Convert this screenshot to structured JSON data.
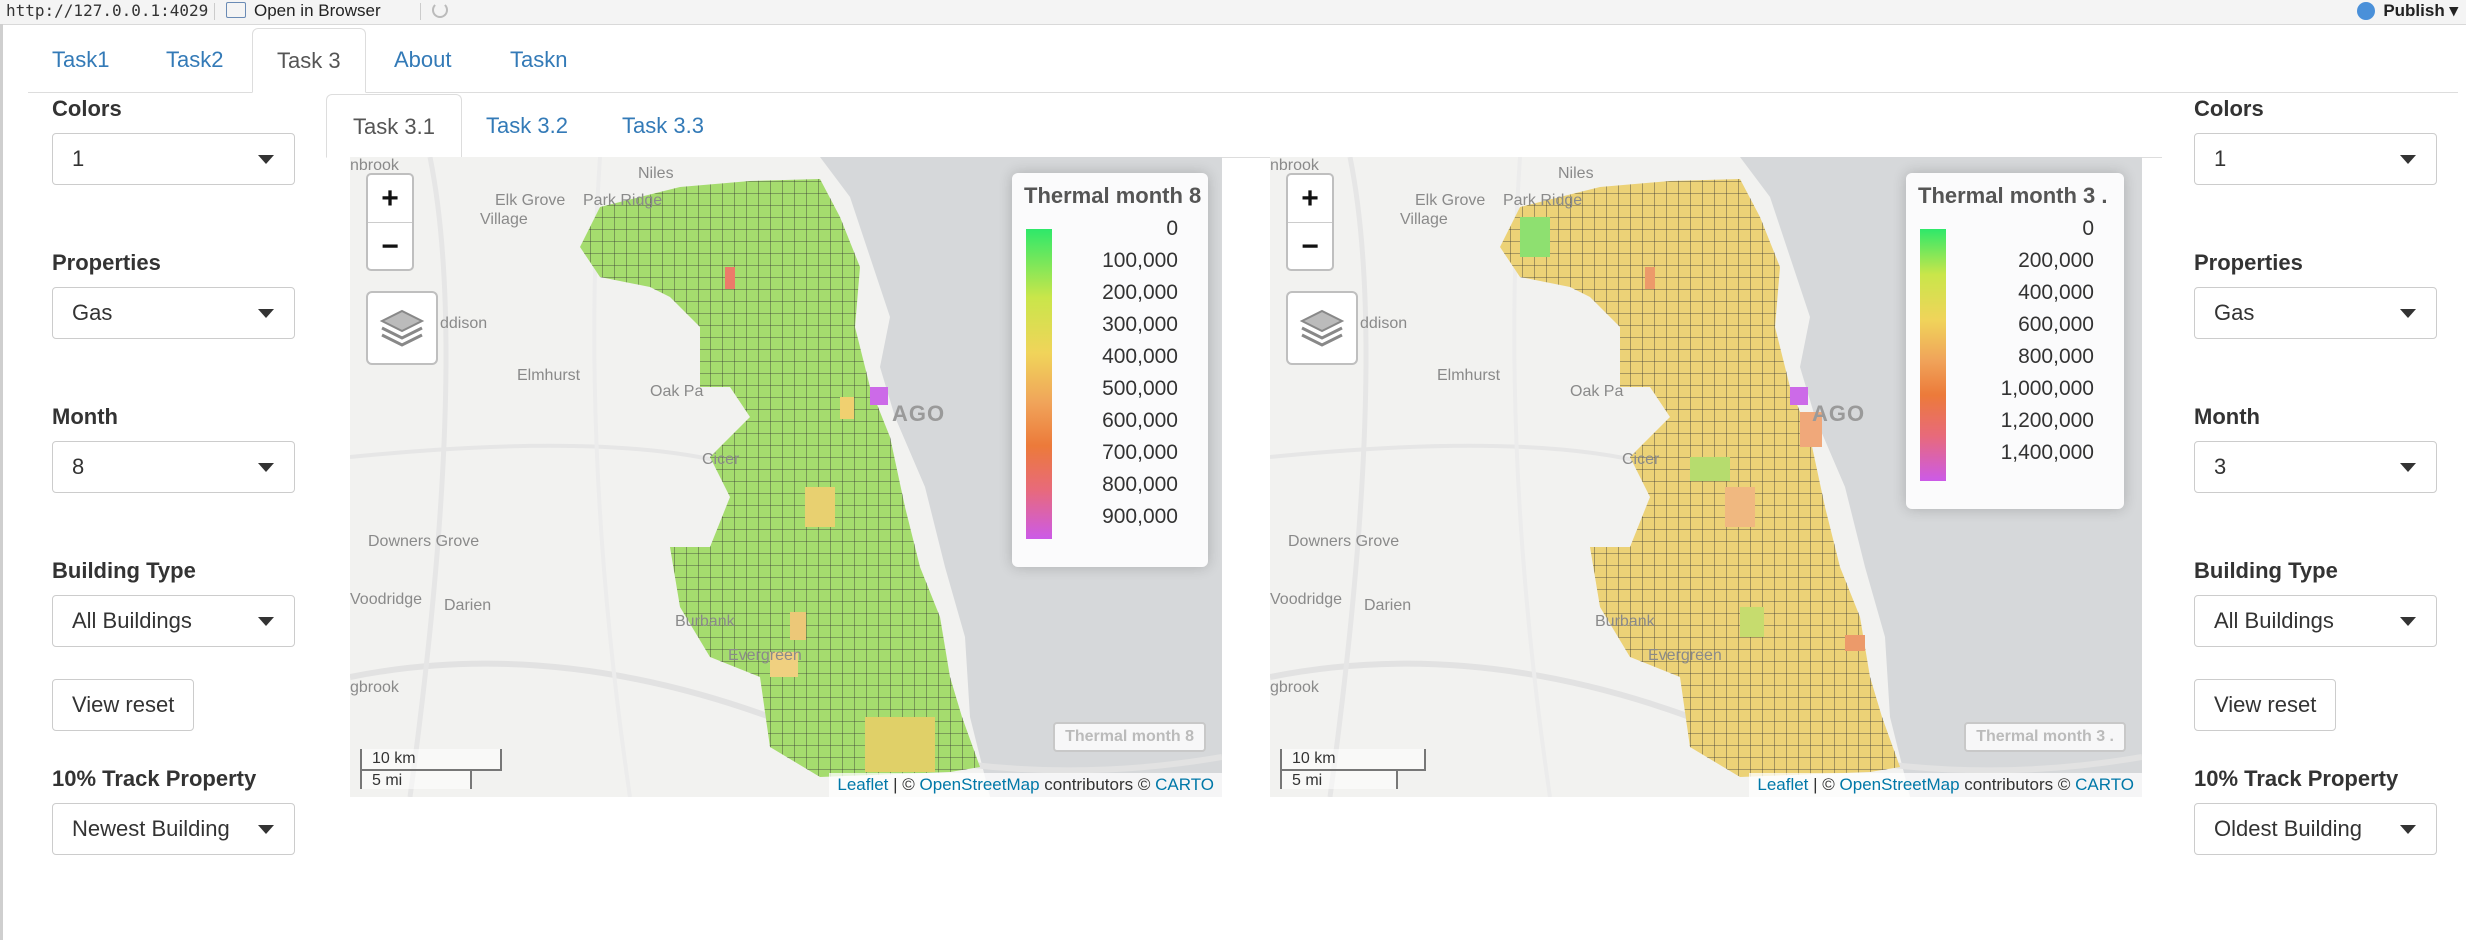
{
  "browser": {
    "url": "http://127.0.0.1:4029",
    "open_in_browser": "Open in Browser",
    "publish": "Publish"
  },
  "main_tabs": [
    "Task1",
    "Task2",
    "Task 3",
    "About",
    "Taskn"
  ],
  "main_tab_active": "Task 3",
  "sub_tabs": [
    "Task 3.1",
    "Task 3.2",
    "Task 3.3"
  ],
  "sub_tab_active": "Task 3.1",
  "left_panel": {
    "colors_label": "Colors",
    "colors_value": "1",
    "properties_label": "Properties",
    "properties_value": "Gas",
    "month_label": "Month",
    "month_value": "8",
    "building_type_label": "Building Type",
    "building_type_value": "All Buildings",
    "view_reset": "View reset",
    "track_label": "10% Track Property",
    "track_value": "Newest Building"
  },
  "right_panel": {
    "colors_label": "Colors",
    "colors_value": "1",
    "properties_label": "Properties",
    "properties_value": "Gas",
    "month_label": "Month",
    "month_value": "3",
    "building_type_label": "Building Type",
    "building_type_value": "All Buildings",
    "view_reset": "View reset",
    "track_label": "10% Track Property",
    "track_value": "Oldest Building"
  },
  "map_places": {
    "niles": "Niles",
    "elk_grove": "Elk Grove",
    "village": "Village",
    "park_ridge": "Park Ridge",
    "addison": "ddison",
    "elmhurst": "Elmhurst",
    "oak_park": "Oak Pa",
    "chicago": "AGO",
    "cicero": "Cicer",
    "downers_grove": "Downers Grove",
    "woodridge": "Voodridge",
    "darien": "Darien",
    "burbank": "Burbank",
    "evergreen": "Evergreen",
    "bolingbrook": "gbrook",
    "northbrook": "nbrook"
  },
  "map_left": {
    "legend_title": "Thermal month 8",
    "legend_ticks": [
      "0",
      "100,000",
      "200,000",
      "300,000",
      "400,000",
      "500,000",
      "600,000",
      "700,000",
      "800,000",
      "900,000"
    ],
    "mini_label": "Thermal month 8",
    "scale_km": "10 km",
    "scale_mi": "5 mi",
    "dominant_color": "#a5dc6e"
  },
  "map_right": {
    "legend_title": "Thermal month 3 .",
    "legend_ticks": [
      "0",
      "200,000",
      "400,000",
      "600,000",
      "800,000",
      "1,000,000",
      "1,200,000",
      "1,400,000"
    ],
    "mini_label": "Thermal month 3 .",
    "scale_km": "10 km",
    "scale_mi": "5 mi",
    "dominant_color": "#ecd277"
  },
  "attribution": {
    "leaflet": "Leaflet",
    "sep": "| ©",
    "osm": "OpenStreetMap",
    "contrib": "contributors ©",
    "carto": "CARTO"
  },
  "colors": {
    "accent": "#337ab7",
    "legend_gradient": [
      "#2ee86a",
      "#c9e64a",
      "#f0d45a",
      "#f0a45a",
      "#ec7a3a",
      "#e86a7a",
      "#cc5ae8"
    ],
    "water": "#d6d8da",
    "land": "#f2f2f0"
  }
}
